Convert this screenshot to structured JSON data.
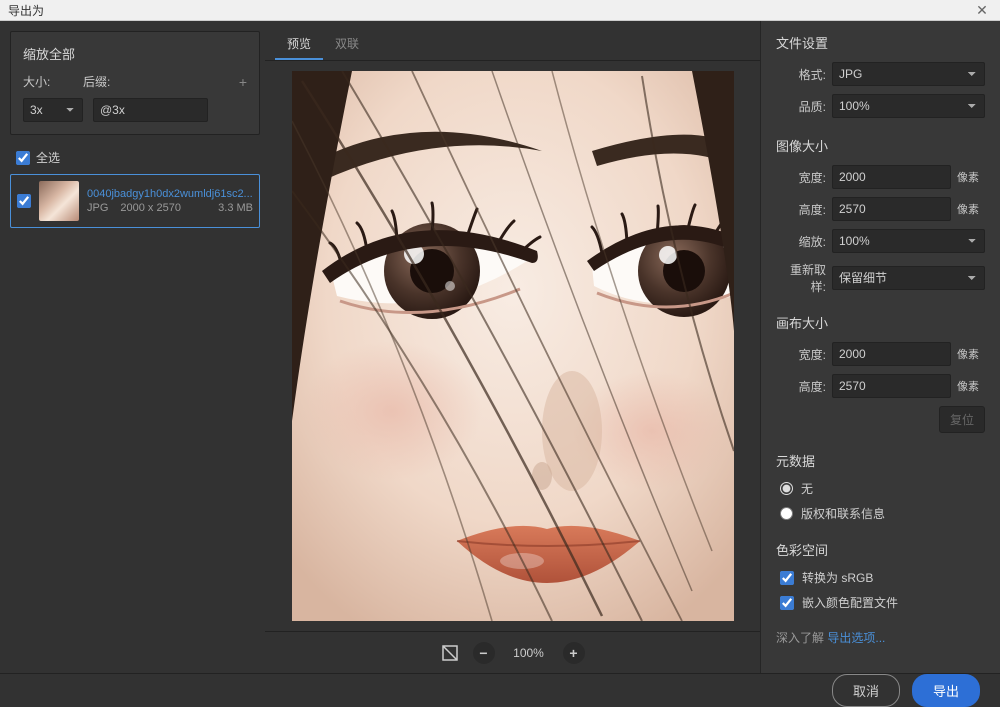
{
  "titlebar": {
    "title": "导出为"
  },
  "left": {
    "scale_title": "缩放全部",
    "size_label": "大小:",
    "suffix_label": "后缀:",
    "size_value": "3x",
    "suffix_value": "@3x",
    "select_all": "全选",
    "asset": {
      "name": "0040jbadgy1h0dx2wumldj61sc2...",
      "format": "JPG",
      "dimensions": "2000 x 2570",
      "filesize": "3.3 MB"
    }
  },
  "center": {
    "tab_preview": "预览",
    "tab_dual": "双联",
    "zoom_pct": "100%"
  },
  "right": {
    "file_settings": {
      "title": "文件设置",
      "format_label": "格式:",
      "format_value": "JPG",
      "quality_label": "品质:",
      "quality_value": "100%"
    },
    "image_size": {
      "title": "图像大小",
      "width_label": "宽度:",
      "width_value": "2000",
      "height_label": "高度:",
      "height_value": "2570",
      "scale_label": "缩放:",
      "scale_value": "100%",
      "resample_label": "重新取样:",
      "resample_value": "保留细节",
      "unit": "像素"
    },
    "canvas_size": {
      "title": "画布大小",
      "width_label": "宽度:",
      "width_value": "2000",
      "height_label": "高度:",
      "height_value": "2570",
      "unit": "像素",
      "reset": "复位"
    },
    "metadata": {
      "title": "元数据",
      "none": "无",
      "copyright": "版权和联系信息"
    },
    "color_space": {
      "title": "色彩空间",
      "convert_srgb": "转换为 sRGB",
      "embed_profile": "嵌入颜色配置文件"
    },
    "learn_more": {
      "text": "深入了解",
      "link": "导出选项..."
    }
  },
  "footer": {
    "cancel": "取消",
    "export": "导出"
  }
}
